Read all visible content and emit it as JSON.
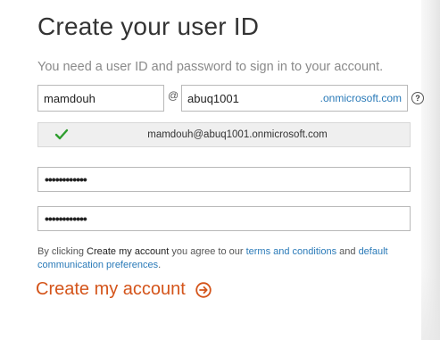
{
  "header": {
    "title": "Create your user ID",
    "subtitle": "You need a user ID and password to sign in to your account."
  },
  "form": {
    "user_id_value": "mamdouh",
    "at_sign": "@",
    "domain_value": "abuq1001",
    "domain_suffix": ".onmicrosoft.com",
    "help_icon_glyph": "?",
    "availability_text": "mamdouh@abuq1001.onmicrosoft.com",
    "password_value": "••••••••••••",
    "confirm_password_value": "••••••••••••"
  },
  "terms": {
    "prefix": "By clicking ",
    "action_name": "Create my account",
    "middle": " you agree to our ",
    "terms_link": "terms and conditions",
    "and": " and ",
    "prefs_link": "default communication preferences",
    "suffix": "."
  },
  "actions": {
    "create_label": "Create my account"
  },
  "colors": {
    "accent": "#d4541a",
    "link": "#2a7ab8",
    "success": "#2f9e2f"
  },
  "icons": {
    "help": "help-circle-icon",
    "check": "checkmark-icon",
    "arrow": "arrow-circle-right-icon"
  }
}
